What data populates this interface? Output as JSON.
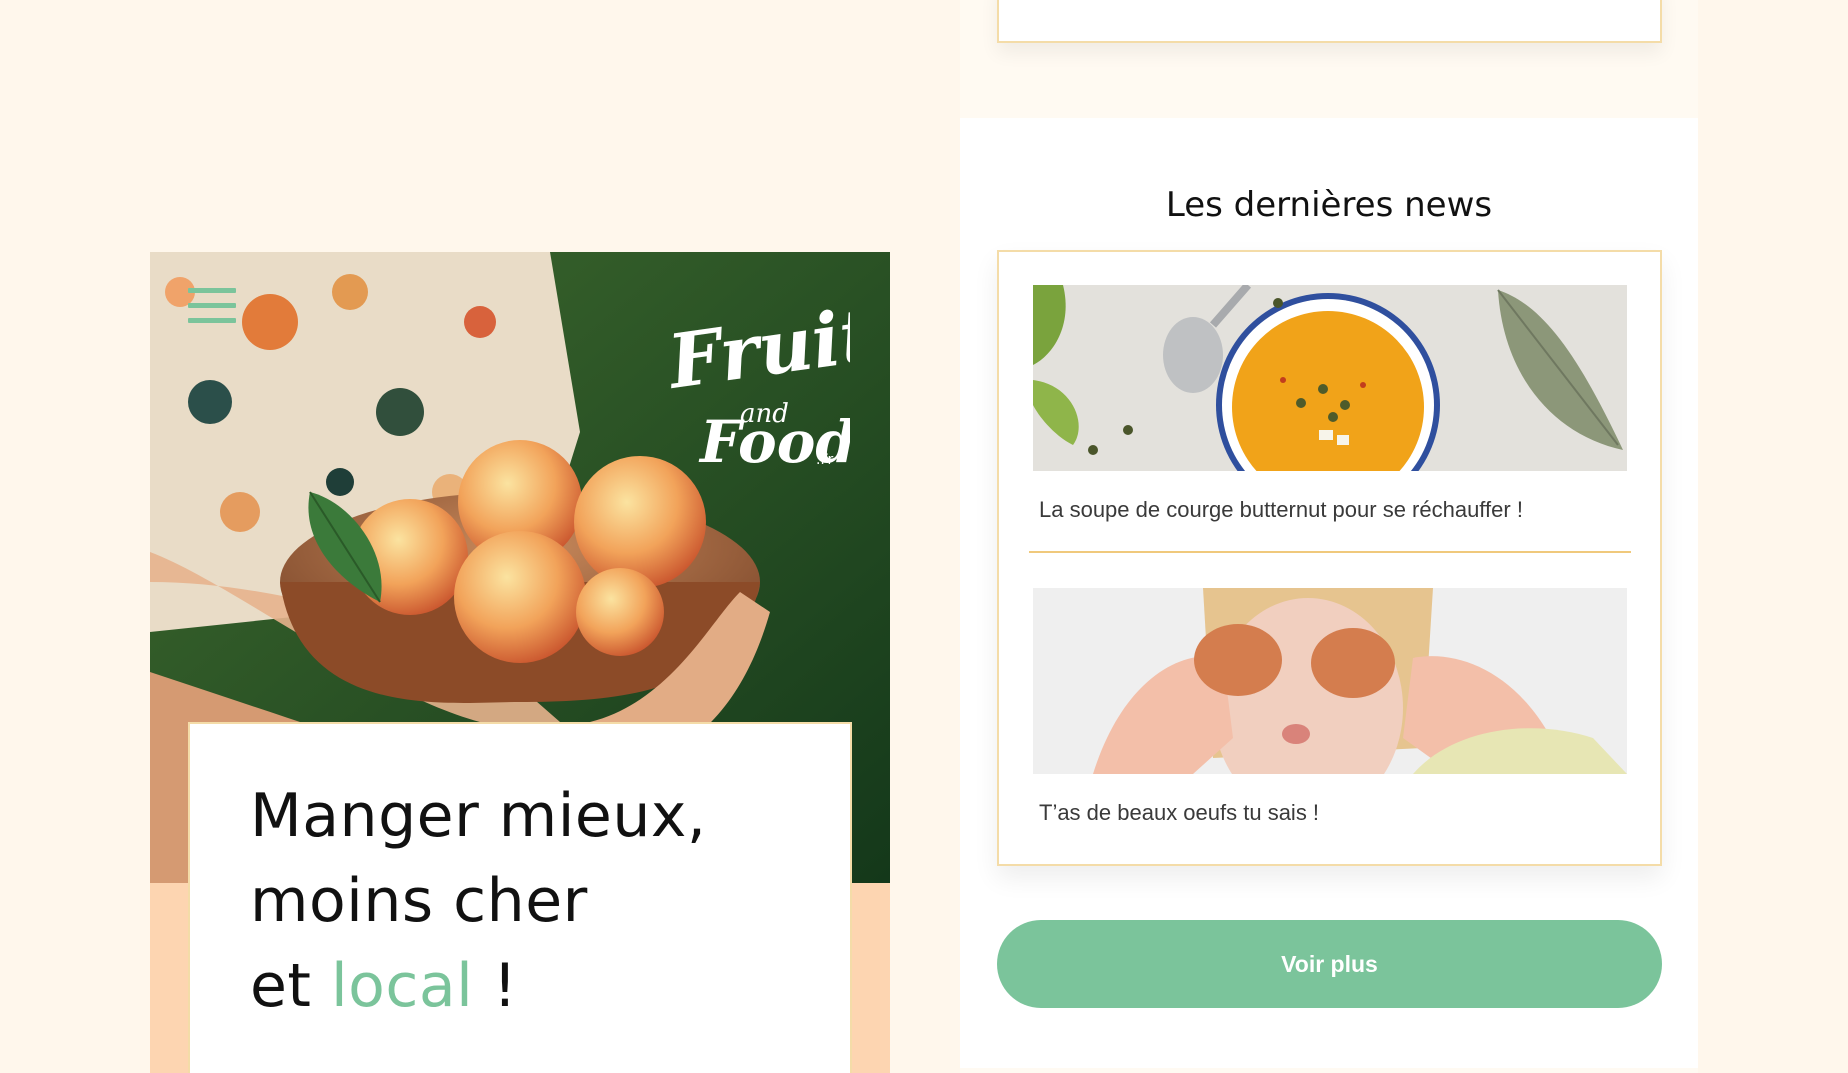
{
  "hero": {
    "menu_icon": "hamburger-menu-icon",
    "logo": {
      "line1": "Fruit",
      "line2": "and",
      "line3": "Food",
      "suffix": ".Fr"
    },
    "headline": {
      "line1": "Manger mieux,",
      "line2": "moins cher",
      "line3_prefix": "et ",
      "line3_accent": "local",
      "line3_suffix": " !"
    }
  },
  "news": {
    "title": "Les dernières news",
    "items": [
      {
        "caption": "La soupe de courge butternut pour se réchauffer !",
        "image": "butternut-soup-photo"
      },
      {
        "caption": "T’as de beaux oeufs tu sais !",
        "image": "child-eggs-eyes-photo"
      }
    ],
    "more_label": "Voir plus"
  },
  "colors": {
    "background": "#fff7ec",
    "accent_green": "#7bc49b",
    "card_border": "#f4dca8",
    "divider": "#f0c97c",
    "peach": "#fdd5b1"
  }
}
